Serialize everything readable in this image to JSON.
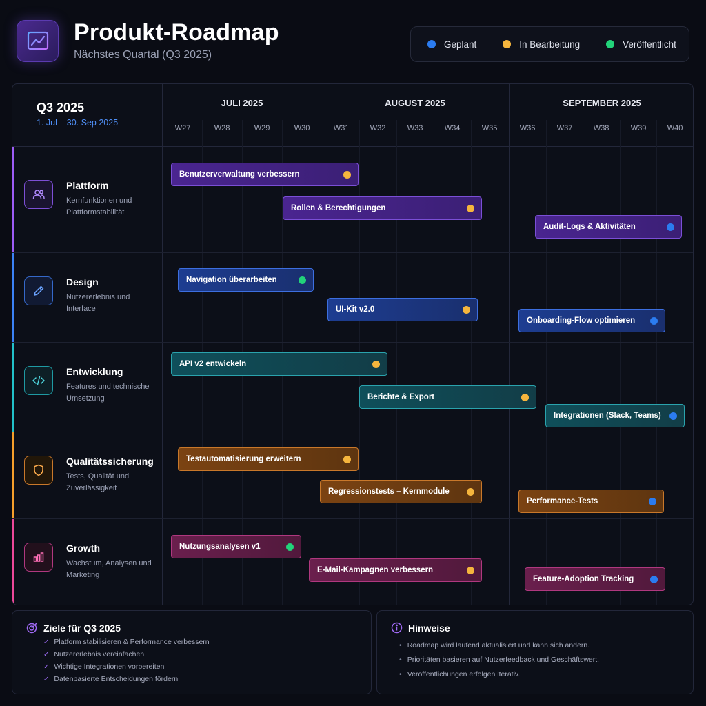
{
  "header": {
    "title": "Produkt-Roadmap",
    "subtitle": "Nächstes Quartal (Q3 2025)",
    "app_icon": "chart-line-icon"
  },
  "legend": [
    {
      "label": "Geplant",
      "color": "#2b7cf0"
    },
    {
      "label": "In Bearbeitung",
      "color": "#f5b53d"
    },
    {
      "label": "Veröffentlicht",
      "color": "#22d37a"
    }
  ],
  "timeline": {
    "quarter": "Q3 2025",
    "range": "1. Jul – 30. Sep 2025",
    "months": [
      "JULI 2025",
      "AUGUST 2025",
      "SEPTEMBER 2025"
    ],
    "weeks": [
      "W27",
      "W28",
      "W29",
      "W30",
      "W31",
      "W32",
      "W33",
      "W34",
      "W35",
      "W36",
      "W37",
      "W38",
      "W39",
      "W40"
    ]
  },
  "lanes": [
    {
      "title": "Plattform",
      "desc": "Kernfunktionen und Plattformstabilität",
      "icon": "users-icon",
      "color": "#9d5cf6",
      "items": [
        {
          "label": "Benutzerverwaltung verbessern",
          "status": "In Bearbeitung"
        },
        {
          "label": "Rollen & Berechtigungen",
          "status": "In Bearbeitung"
        },
        {
          "label": "Audit-Logs & Aktivitäten",
          "status": "Geplant"
        }
      ]
    },
    {
      "title": "Design",
      "desc": "Nutzererlebnis und Interface",
      "icon": "pencil-icon",
      "color": "#3b82f6",
      "items": [
        {
          "label": "Navigation überarbeiten",
          "status": "Veröffentlicht"
        },
        {
          "label": "UI-Kit v2.0",
          "status": "In Bearbeitung"
        },
        {
          "label": "Onboarding-Flow optimieren",
          "status": "Geplant"
        }
      ]
    },
    {
      "title": "Entwicklung",
      "desc": "Features und technische Umsetzung",
      "icon": "code-icon",
      "color": "#22c1c9",
      "items": [
        {
          "label": "API v2 entwickeln",
          "status": "In Bearbeitung"
        },
        {
          "label": "Berichte & Export",
          "status": "In Bearbeitung"
        },
        {
          "label": "Integrationen (Slack, Teams)",
          "status": "Geplant"
        }
      ]
    },
    {
      "title": "Qualitätssicherung",
      "desc": "Tests, Qualität und Zuverlässigkeit",
      "icon": "shield-icon",
      "color": "#f59e2b",
      "items": [
        {
          "label": "Testautomatisierung erweitern",
          "status": "In Bearbeitung"
        },
        {
          "label": "Regressionstests – Kernmodule",
          "status": "In Bearbeitung"
        },
        {
          "label": "Performance-Tests",
          "status": "Geplant"
        }
      ]
    },
    {
      "title": "Growth",
      "desc": "Wachstum, Analysen und Marketing",
      "icon": "bar-chart-icon",
      "color": "#ec4899",
      "items": [
        {
          "label": "Nutzungsanalysen v1",
          "status": "Veröffentlicht"
        },
        {
          "label": "E-Mail-Kampagnen verbessern",
          "status": "In Bearbeitung"
        },
        {
          "label": "Feature-Adoption Tracking",
          "status": "Geplant"
        }
      ]
    }
  ],
  "goals": {
    "title": "Ziele für Q3 2025",
    "icon": "target-icon",
    "items": [
      "Platform stabilisieren & Performance verbessern",
      "Nutzererlebnis vereinfachen",
      "Wichtige Integrationen vorbereiten",
      "Datenbasierte Entscheidungen fördern"
    ]
  },
  "notes": {
    "title": "Hinweise",
    "icon": "info-icon",
    "items": [
      "Roadmap wird laufend aktualisiert und kann sich ändern.",
      "Prioritäten basieren auf Nutzerfeedback und Geschäftswert.",
      "Veröffentlichungen erfolgen iterativ."
    ]
  }
}
